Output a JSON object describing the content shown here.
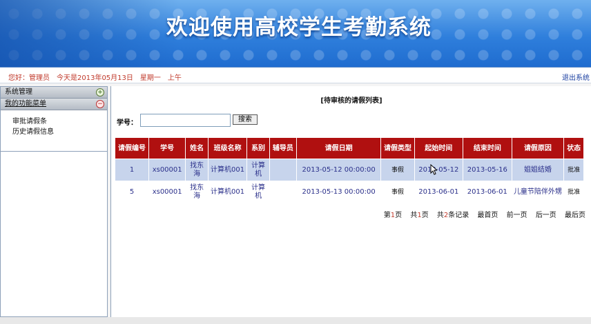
{
  "app": {
    "title": "欢迎使用高校学生考勤系统"
  },
  "info": {
    "greeting": "您好：管理员　今天是2013年05月13日　星期一　上午",
    "logout": "退出系统"
  },
  "sidebar": {
    "section1": "系统管理",
    "section2": "我的功能菜单",
    "items": [
      {
        "label": "审批请假条"
      },
      {
        "label": "历史请假信息"
      }
    ]
  },
  "main": {
    "list_title": "[待审核的请假列表]",
    "search": {
      "label": "学号：",
      "placeholder": "",
      "value": "",
      "button": "搜索"
    },
    "columns": [
      "请假编号",
      "学号",
      "姓名",
      "班级名称",
      "系别",
      "辅导员",
      "请假日期",
      "请假类型",
      "起始时间",
      "结束时间",
      "请假原因",
      "状态"
    ],
    "rows": [
      [
        "1",
        "xs00001",
        "找东海",
        "计算机001",
        "计算机",
        "",
        "2013-05-12 00:00:00",
        "事假",
        "2013-05-12",
        "2013-05-16",
        "姐姐结婚",
        "批准"
      ],
      [
        "5",
        "xs00001",
        "找东海",
        "计算机001",
        "计算机",
        "",
        "2013-05-13 00:00:00",
        "事假",
        "2013-06-01",
        "2013-06-01",
        "儿童节陪伴外甥",
        "批准"
      ]
    ],
    "pager": {
      "page_prefix": "第",
      "page": "1",
      "page_suffix": "页",
      "total_prefix": "共",
      "total_pages": "1",
      "total_suffix": "页",
      "records_prefix": "共",
      "records": "2",
      "records_suffix": "条记录",
      "first": "最首页",
      "prev": "前一页",
      "next": "后一页",
      "last": "最后页"
    }
  },
  "icons": {
    "expand": "plus-circle-icon",
    "collapse": "minus-circle-icon"
  },
  "colors": {
    "header_red": "#b01010",
    "row_highlight": "#c7d4ec",
    "banner_blue": "#2f7fdc"
  }
}
